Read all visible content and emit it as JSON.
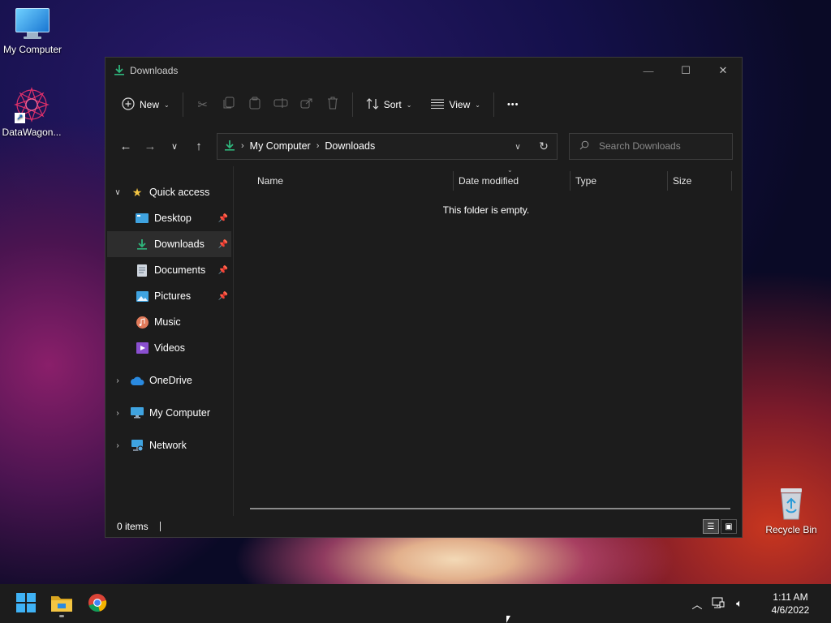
{
  "desktop": {
    "icons": [
      {
        "label": "My Computer"
      },
      {
        "label": "DataWagon..."
      },
      {
        "label": "Recycle Bin"
      }
    ]
  },
  "window": {
    "title": "Downloads",
    "controls": {
      "minimize": "—",
      "maximize": "☐",
      "close": "✕"
    }
  },
  "toolbar": {
    "new_label": "New",
    "sort_label": "Sort",
    "view_label": "View",
    "more_label": "•••"
  },
  "address": {
    "crumbs": [
      "My Computer",
      "Downloads"
    ],
    "separator": "›"
  },
  "search": {
    "placeholder": "Search Downloads"
  },
  "sidebar": {
    "quick_access": "Quick access",
    "items": [
      {
        "label": "Desktop",
        "pinned": true
      },
      {
        "label": "Downloads",
        "pinned": true,
        "selected": true
      },
      {
        "label": "Documents",
        "pinned": true
      },
      {
        "label": "Pictures",
        "pinned": true
      },
      {
        "label": "Music",
        "pinned": false
      },
      {
        "label": "Videos",
        "pinned": false
      }
    ],
    "roots": [
      {
        "label": "OneDrive"
      },
      {
        "label": "My Computer"
      },
      {
        "label": "Network"
      }
    ]
  },
  "columns": [
    "Name",
    "Date modified",
    "Type",
    "Size"
  ],
  "empty_message": "This folder is empty.",
  "status": {
    "items": "0 items"
  },
  "taskbar": {
    "time": "1:11 AM",
    "date": "4/6/2022"
  },
  "colors": {
    "window_bg": "#1c1c1c",
    "accent_green": "#2fb67c",
    "folder_yellow": "#f4c542",
    "selected_bg": "#2d2d2d"
  }
}
